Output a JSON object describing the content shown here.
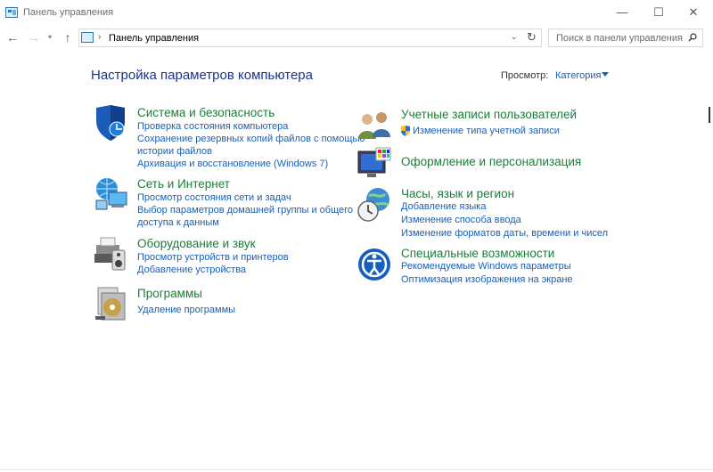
{
  "window": {
    "title": "Панель управления",
    "minimize": "—",
    "maximize": "☐",
    "close": "✕"
  },
  "nav": {
    "back": "←",
    "forward": "→",
    "recent": "▾",
    "up": "↑",
    "address_separator": "›",
    "address": "Панель управления",
    "address_dropdown": "⌄",
    "refresh": "↻",
    "search_placeholder": "Поиск в панели управления"
  },
  "header": {
    "title": "Настройка параметров компьютера",
    "view_label": "Просмотр:",
    "view_value": "Категория"
  },
  "categories": {
    "system": {
      "icon": "shield-icon",
      "title": "Система и безопасность",
      "links": [
        "Проверка состояния компьютера",
        "Сохранение резервных копий файлов с помощью",
        "истории файлов",
        "Архивация и восстановление (Windows 7)"
      ]
    },
    "network": {
      "icon": "network-globe-icon",
      "title": "Сеть и Интернет",
      "links": [
        "Просмотр состояния сети и задач",
        "Выбор параметров домашней группы и общего",
        "доступа к данным"
      ]
    },
    "hardware": {
      "icon": "printer-speaker-icon",
      "title": "Оборудование и звук",
      "links": [
        "Просмотр устройств и принтеров",
        "Добавление устройства"
      ]
    },
    "programs": {
      "icon": "programs-disc-icon",
      "title": "Программы",
      "links": [
        "Удаление программы"
      ]
    },
    "users": {
      "icon": "users-icon",
      "title": "Учетные записи пользователей",
      "links": [
        "Изменение типа учетной записи"
      ]
    },
    "appearance": {
      "icon": "monitor-palette-icon",
      "title": "Оформление и персонализация",
      "links": []
    },
    "clock": {
      "icon": "clock-globe-icon",
      "title": "Часы, язык и регион",
      "links": [
        "Добавление языка",
        "Изменение способа ввода",
        "Изменение форматов даты, времени и чисел"
      ]
    },
    "access": {
      "icon": "ease-of-access-icon",
      "title": "Специальные возможности",
      "links": [
        "Рекомендуемые Windows параметры",
        "Оптимизация изображения на экране"
      ]
    }
  },
  "colors": {
    "category_title": "#1a7f37",
    "link": "#1a5fb4",
    "page_title": "#1e3287"
  }
}
